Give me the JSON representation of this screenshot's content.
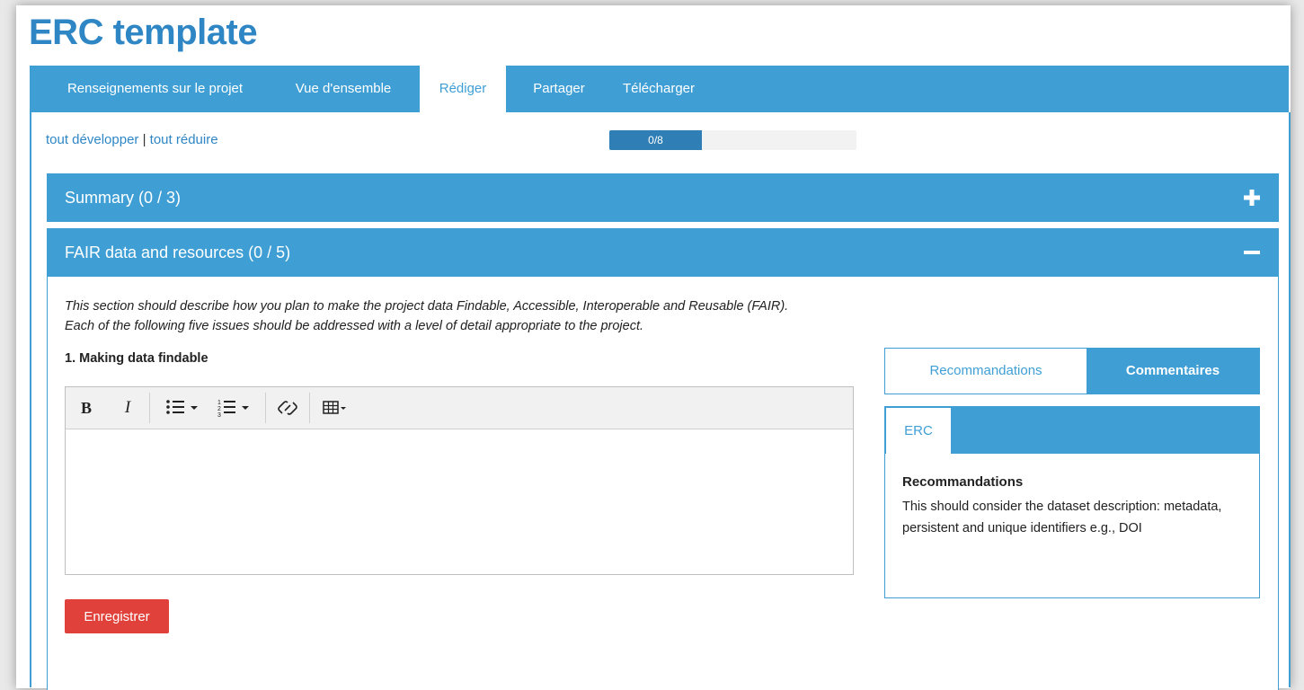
{
  "page_title": "ERC template",
  "tabs": [
    {
      "label": "Renseignements sur le projet",
      "active": false
    },
    {
      "label": "Vue d'ensemble",
      "active": false
    },
    {
      "label": "Rédiger",
      "active": true
    },
    {
      "label": "Partager",
      "active": false
    },
    {
      "label": "Télécharger",
      "active": false
    }
  ],
  "expand_all": "tout développer",
  "separator": "|",
  "collapse_all": "tout réduire",
  "progress": {
    "label": "0/8",
    "answered": 0,
    "total": 8
  },
  "sections": [
    {
      "label": "Summary (0 / 3)",
      "state": "collapsed",
      "icon": "plus-icon"
    },
    {
      "label": "FAIR data and resources (0 / 5)",
      "state": "expanded",
      "icon": "minus-icon"
    }
  ],
  "section_intro": {
    "line1": "This section should describe how you plan to make the project data Findable, Accessible, Interoperable and Reusable (FAIR).",
    "line2": "Each of the following five issues should be addressed with a level of detail appropriate to the project."
  },
  "question": {
    "label": "1. Making data findable",
    "answer": ""
  },
  "editor_toolbar": [
    "bold-icon",
    "italic-icon",
    "bullet-list-icon",
    "numbered-list-icon",
    "link-icon",
    "table-icon"
  ],
  "toolbar_glyphs": {
    "bold": "B",
    "italic": "I"
  },
  "save_label": "Enregistrer",
  "guidance_tabs": [
    {
      "label": "Recommandations",
      "active": false
    },
    {
      "label": "Commentaires",
      "active": true
    }
  ],
  "guidance": {
    "org_tab": "ERC",
    "title": "Recommandations",
    "text": "This should consider the dataset description: metadata, persistent and unique identifiers e.g., DOI"
  },
  "colors": {
    "primary": "#3f9fd5",
    "title": "#2f86c4",
    "progress_fill": "#2f7fb6",
    "save": "#e0413a"
  }
}
